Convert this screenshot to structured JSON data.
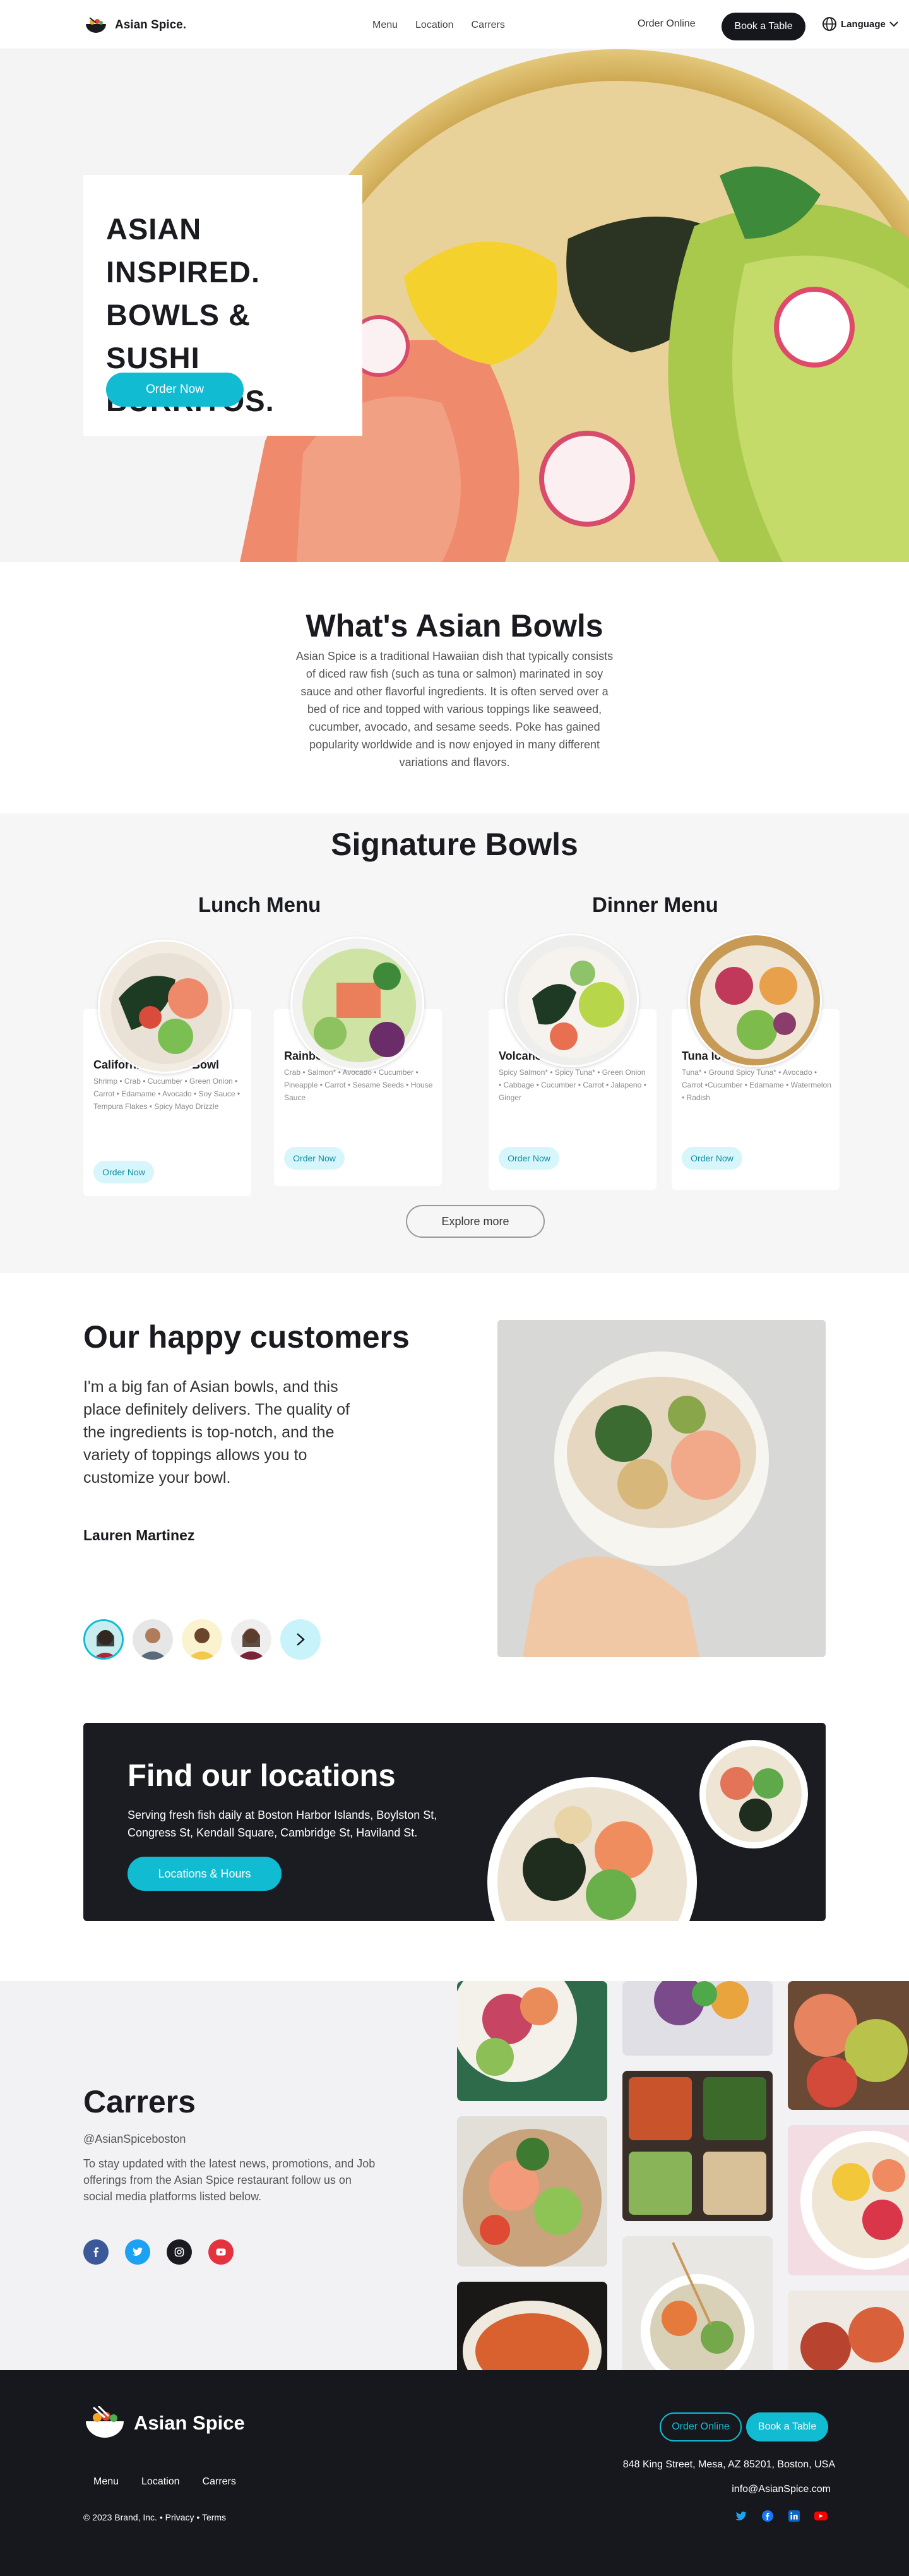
{
  "nav": {
    "brand": "Asian Spice.",
    "links": [
      "Menu",
      "Location",
      "Carrers"
    ],
    "order_online": "Order Online",
    "book_table": "Book a Table",
    "language": "Language"
  },
  "hero": {
    "title": "ASIAN INSPIRED. BOWLS & SUSHI BURRITOS.",
    "cta": "Order Now"
  },
  "whats": {
    "title": "What's Asian Bowls",
    "text": "Asian Spice is a traditional Hawaiian dish that typically consists of diced raw fish (such as tuna or salmon) marinated in soy sauce and other flavorful ingredients. It is often served over a bed of rice and topped with various toppings like seaweed, cucumber, avocado, and sesame seeds. Poke has gained popularity worldwide and is now enjoyed in many different variations and flavors."
  },
  "signature": {
    "title": "Signature Bowls",
    "lunch_title": "Lunch Menu",
    "dinner_title": "Dinner Menu",
    "bowls": [
      {
        "name": "California Crunch Bowl",
        "ingredients": "Shrimp • Crab • Cucumber • Green Onion • Carrot • Edamame • Avocado • Soy Sauce • Tempura Flakes • Spicy Mayo Drizzle",
        "cta": "Order Now"
      },
      {
        "name": "Rainbow Bowl",
        "ingredients": "Crab • Salmon* • Avocado • Cucumber • Pineapple • Carrot • Sesame Seeds • House Sauce",
        "cta": "Order Now"
      },
      {
        "name": "Volcano Bowl",
        "ingredients": "Spicy Salmon* • Spicy Tuna* • Green Onion • Cabbage • Cucumber • Carrot • Jalapeno • Ginger",
        "cta": "Order Now"
      },
      {
        "name": "Tuna lover's Bowl",
        "ingredients": "Tuna* • Ground Spicy Tuna* • Avocado • Carrot •Cucumber • Edamame • Watermelon • Radish",
        "cta": "Order Now"
      }
    ],
    "explore": "Explore more"
  },
  "customers": {
    "title": "Our happy customers",
    "quote": "I'm a big fan of Asian bowls, and this place definitely delivers. The quality of the ingredients is top-notch, and the variety of toppings allows you to customize your bowl.",
    "name": "Lauren Martinez"
  },
  "locations": {
    "title": "Find our locations",
    "text": "Serving fresh fish daily at Boston Harbor Islands, Boylston St, Congress St, Kendall Square, Cambridge St, Haviland St.",
    "cta": "Locations & Hours"
  },
  "carrers": {
    "title": "Carrers",
    "handle": "@AsianSpiceboston",
    "text": "To stay updated with the latest news, promotions, and Job offerings from the Asian Spice restaurant follow us on social media platforms listed below.",
    "socials": [
      "facebook-icon",
      "twitter-icon",
      "instagram-icon",
      "youtube-icon"
    ]
  },
  "footer": {
    "brand": "Asian Spice",
    "links": [
      "Menu",
      "Location",
      "Carrers"
    ],
    "copyright": "© 2023 Brand, Inc. • Privacy • Terms",
    "order_online": "Order Online",
    "book_table": "Book a Table",
    "address": "848 King Street, Mesa, AZ 85201, Boston, USA",
    "email": "info@AsianSpice.com"
  },
  "colors": {
    "accent": "#11bcd2",
    "dark": "#1a1b20",
    "light_teal": "#d7f6fb"
  }
}
